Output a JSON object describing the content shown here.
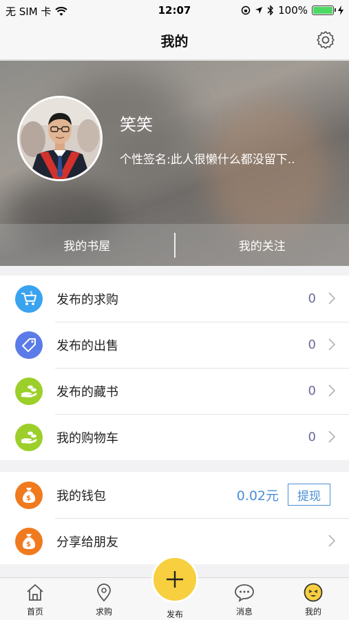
{
  "status_bar": {
    "carrier": "无 SIM 卡",
    "time": "12:07",
    "battery_percent": "100%",
    "battery_level": 1.0
  },
  "nav": {
    "title": "我的"
  },
  "profile": {
    "nickname": "笑笑",
    "signature": "个性签名:此人很懒什么都没留下..",
    "tabs": [
      "我的书屋",
      "我的关注"
    ]
  },
  "list_group_1": [
    {
      "label": "发布的求购",
      "count": "0",
      "icon": "cart-icon",
      "color": "#3aa3f0"
    },
    {
      "label": "发布的出售",
      "count": "0",
      "icon": "tag-icon",
      "color": "#5b7ce8"
    },
    {
      "label": "发布的藏书",
      "count": "0",
      "icon": "hand-coins-icon",
      "color": "#9ccf2a"
    },
    {
      "label": "我的购物车",
      "count": "0",
      "icon": "hand-coins-icon",
      "color": "#9ccf2a"
    }
  ],
  "list_group_2": {
    "wallet": {
      "label": "我的钱包",
      "amount": "0.02元",
      "button": "提现",
      "icon": "money-bag-icon",
      "color": "#f07a1e"
    },
    "share": {
      "label": "分享给朋友",
      "icon": "money-bag-icon",
      "color": "#f07a1e"
    }
  },
  "tabbar": {
    "items": [
      {
        "label": "首页",
        "icon": "home-icon"
      },
      {
        "label": "求购",
        "icon": "location-icon"
      },
      {
        "label": "发布",
        "icon": "plus-icon"
      },
      {
        "label": "消息",
        "icon": "chat-icon"
      },
      {
        "label": "我的",
        "icon": "face-icon"
      }
    ]
  }
}
